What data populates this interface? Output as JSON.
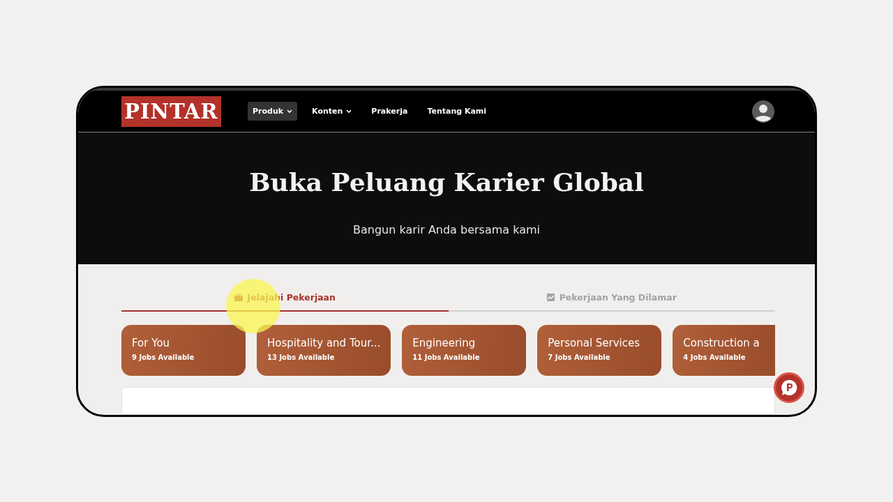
{
  "nav": {
    "logo": "PINTAR",
    "items": [
      {
        "label": "Produk",
        "dropdown": true,
        "selected": true
      },
      {
        "label": "Konten",
        "dropdown": true,
        "selected": false
      },
      {
        "label": "Prakerja",
        "dropdown": false,
        "selected": false
      },
      {
        "label": "Tentang Kami",
        "dropdown": false,
        "selected": false
      }
    ]
  },
  "hero": {
    "title": "Buka Peluang Karier Global",
    "subtitle": "Bangun karir Anda bersama kami"
  },
  "tabs": [
    {
      "label": "Jelajahi Pekerjaan",
      "kind": "briefcase",
      "selected": true
    },
    {
      "label": "Pekerjaan Yang Dilamar",
      "kind": "chart",
      "selected": false
    }
  ],
  "categories": [
    {
      "name": "For You",
      "count": "9 Jobs Available"
    },
    {
      "name": "Hospitality and Tour...",
      "count": "13 Jobs Available"
    },
    {
      "name": "Engineering",
      "count": "11 Jobs Available"
    },
    {
      "name": "Personal Services",
      "count": "7 Jobs Available"
    },
    {
      "name": "Construction a",
      "count": "4 Jobs Available"
    }
  ]
}
